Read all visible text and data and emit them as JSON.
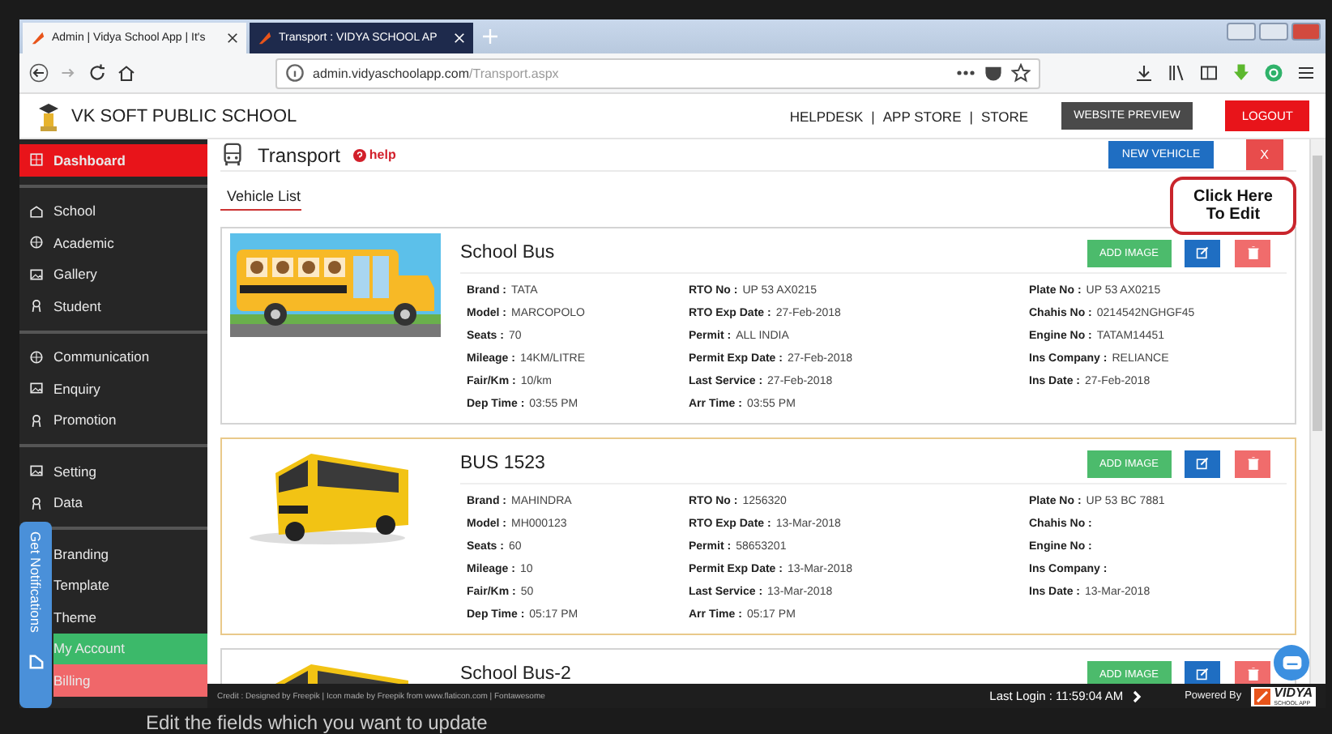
{
  "browser": {
    "tabs": [
      {
        "title": "Admin | Vidya School App | It's",
        "selected": true
      },
      {
        "title": "Transport : VIDYA SCHOOL AP",
        "selected": false
      }
    ],
    "url_host": "admin.vidyaschoolapp.com",
    "url_path": "/Transport.aspx"
  },
  "header": {
    "school_name": "VK SOFT PUBLIC SCHOOL",
    "links": [
      "HELPDESK",
      "APP STORE",
      "STORE"
    ],
    "separator": "|",
    "website_preview": "WEBSITE PREVIEW",
    "logout": "LOGOUT"
  },
  "sidebar": {
    "groups": [
      [
        {
          "label": "Dashboard",
          "selected": true,
          "color": "#e8141a"
        }
      ],
      [
        {
          "label": "School",
          "selected": false
        },
        {
          "label": "Academic",
          "selected": false
        },
        {
          "label": "Gallery",
          "selected": false
        },
        {
          "label": "Student",
          "selected": false
        }
      ],
      [
        {
          "label": "Communication",
          "selected": false
        },
        {
          "label": "Enquiry",
          "selected": false
        },
        {
          "label": "Promotion",
          "selected": false
        }
      ],
      [
        {
          "label": "Setting",
          "selected": false
        },
        {
          "label": "Data",
          "selected": false
        }
      ],
      [
        {
          "label": "Branding",
          "selected": false
        },
        {
          "label": "Template",
          "selected": false
        },
        {
          "label": "Theme",
          "selected": false
        },
        {
          "label": "My Account",
          "selected": false,
          "color": "#3cb96a"
        },
        {
          "label": "Billing",
          "selected": false,
          "color": "#f0676a"
        }
      ]
    ],
    "notifications_tab": "Get Notifications"
  },
  "page": {
    "title": "Transport",
    "help": "help",
    "new_vehicle": "NEW VEHICLE",
    "close": "X",
    "section_tab": "Vehicle List",
    "callout": [
      "Click Here",
      "To Edit"
    ]
  },
  "vehicles": [
    {
      "name": "School Bus",
      "highlighted": false,
      "kind": "cartoon",
      "add_image": "ADD IMAGE",
      "columns": [
        [
          {
            "label": "Brand :",
            "value": "TATA"
          },
          {
            "label": "Model :",
            "value": "MARCOPOLO"
          },
          {
            "label": "Seats :",
            "value": "70"
          },
          {
            "label": "Mileage :",
            "value": "14KM/LITRE"
          },
          {
            "label": "Fair/Km :",
            "value": "10/km"
          },
          {
            "label": "Dep Time :",
            "value": "03:55 PM"
          }
        ],
        [
          {
            "label": "RTO No :",
            "value": "UP 53 AX0215"
          },
          {
            "label": "RTO Exp Date :",
            "value": "27-Feb-2018"
          },
          {
            "label": "Permit :",
            "value": "ALL INDIA"
          },
          {
            "label": "Permit Exp Date :",
            "value": "27-Feb-2018"
          },
          {
            "label": "Last Service :",
            "value": "27-Feb-2018"
          },
          {
            "label": "Arr Time :",
            "value": "03:55 PM"
          }
        ],
        [
          {
            "label": "Plate No :",
            "value": "UP 53 AX0215"
          },
          {
            "label": "Chahis No :",
            "value": "0214542NGHGF45"
          },
          {
            "label": "Engine No :",
            "value": "TATAM14451"
          },
          {
            "label": "Ins Company :",
            "value": "RELIANCE"
          },
          {
            "label": "Ins Date :",
            "value": "27-Feb-2018"
          }
        ]
      ]
    },
    {
      "name": "BUS 1523",
      "highlighted": true,
      "kind": "photo",
      "add_image": "ADD IMAGE",
      "columns": [
        [
          {
            "label": "Brand :",
            "value": "MAHINDRA"
          },
          {
            "label": "Model :",
            "value": "MH000123"
          },
          {
            "label": "Seats :",
            "value": "60"
          },
          {
            "label": "Mileage :",
            "value": "10"
          },
          {
            "label": "Fair/Km :",
            "value": "50"
          },
          {
            "label": "Dep Time :",
            "value": "05:17 PM"
          }
        ],
        [
          {
            "label": "RTO No :",
            "value": "1256320"
          },
          {
            "label": "RTO Exp Date :",
            "value": "13-Mar-2018"
          },
          {
            "label": "Permit :",
            "value": "58653201"
          },
          {
            "label": "Permit Exp Date :",
            "value": "13-Mar-2018"
          },
          {
            "label": "Last Service :",
            "value": "13-Mar-2018"
          },
          {
            "label": "Arr Time :",
            "value": "05:17 PM"
          }
        ],
        [
          {
            "label": "Plate No :",
            "value": "UP 53 BC 7881"
          },
          {
            "label": "Chahis No :"
          },
          {
            "label": "Engine No :"
          },
          {
            "label": "Ins Company :"
          },
          {
            "label": "Ins Date :",
            "value": "13-Mar-2018"
          }
        ]
      ]
    },
    {
      "name": "School Bus-2",
      "highlighted": false,
      "kind": "photo",
      "add_image": "ADD IMAGE"
    }
  ],
  "footer": {
    "credit": "Credit : Designed by Freepik | Icon made by Freepik from www.flaticon.com | Fontawesome",
    "last_login": "Last Login : 11:59:04 AM",
    "powered_by": "Powered By",
    "brand": "VIDYA",
    "brand_sub": "SCHOOL APP"
  },
  "caption": "Edit the fields which you want to update"
}
